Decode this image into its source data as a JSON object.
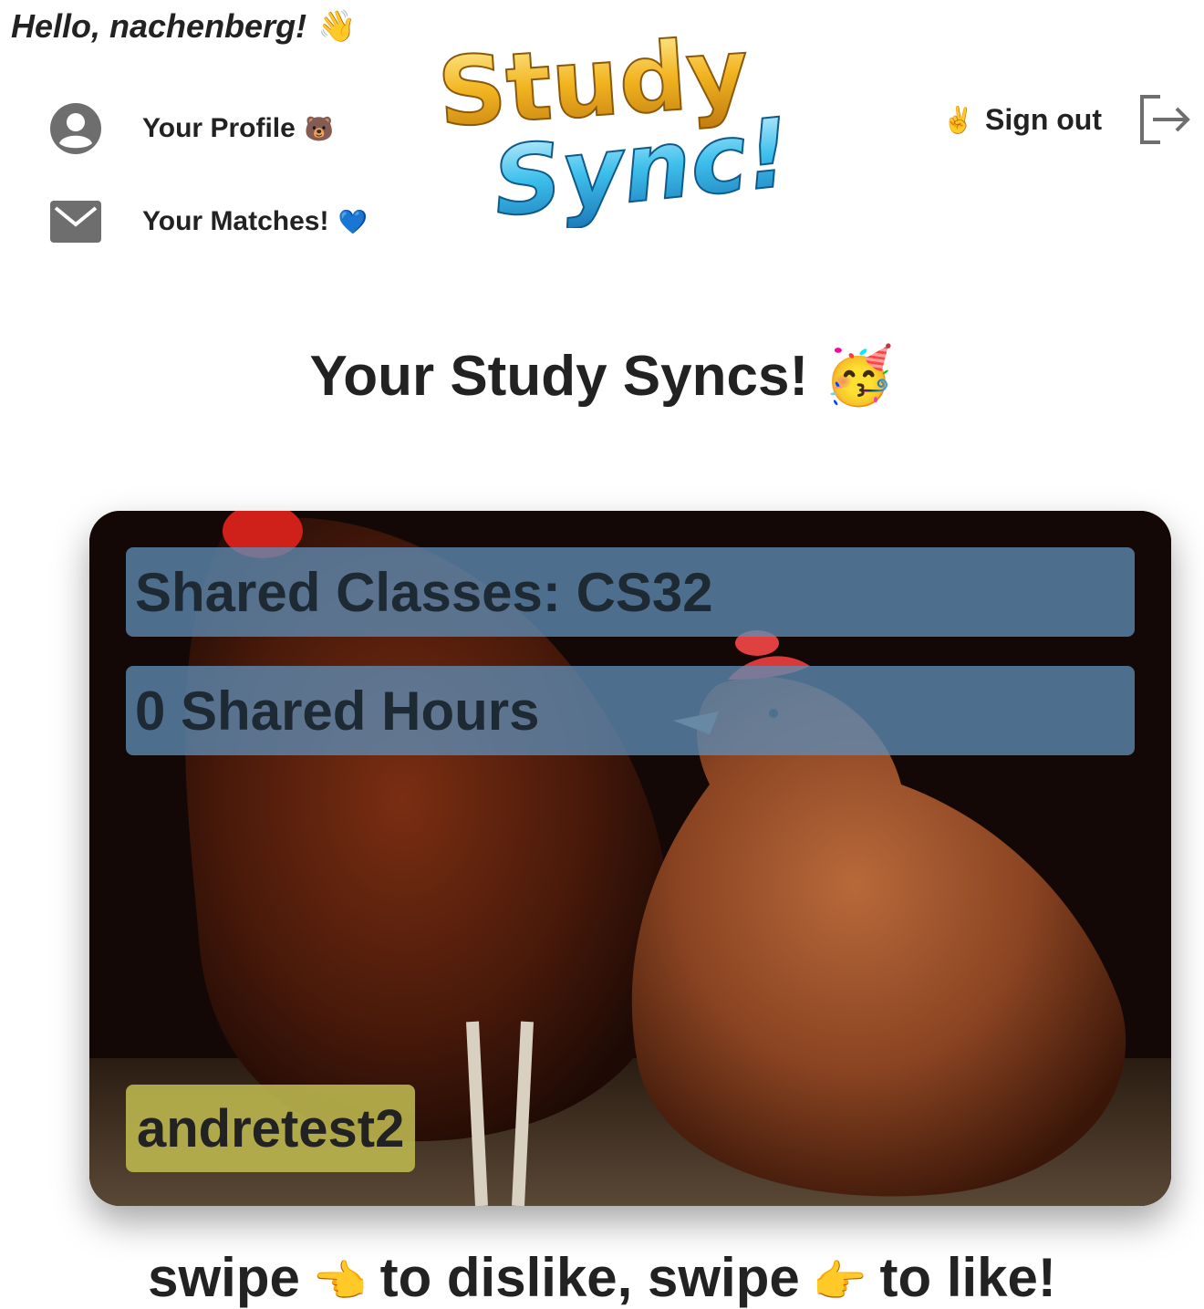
{
  "header": {
    "greeting": "Hello, nachenberg!",
    "greeting_emoji": "👋",
    "logo_line1": "Study",
    "logo_line2": "Sync!",
    "signout_emoji": "✌️",
    "signout_label": "Sign out"
  },
  "nav": {
    "profile_label": "Your Profile",
    "profile_emoji": "🐻",
    "matches_label": "Your Matches!",
    "matches_emoji": "💙"
  },
  "main": {
    "title": "Your Study Syncs!",
    "title_emoji": "🥳"
  },
  "card": {
    "shared_classes": "Shared Classes: CS32",
    "shared_hours": "0 Shared Hours",
    "username": "andretest2"
  },
  "footer": {
    "hint_part1": "swipe",
    "dislike_emoji": "👈",
    "hint_part2": "to dislike, swipe",
    "like_emoji": "👉",
    "hint_part3": "to like!"
  },
  "colors": {
    "pill_blue": "#5f8cb4",
    "name_tag_yellow": "#beb950",
    "text": "#222222"
  }
}
